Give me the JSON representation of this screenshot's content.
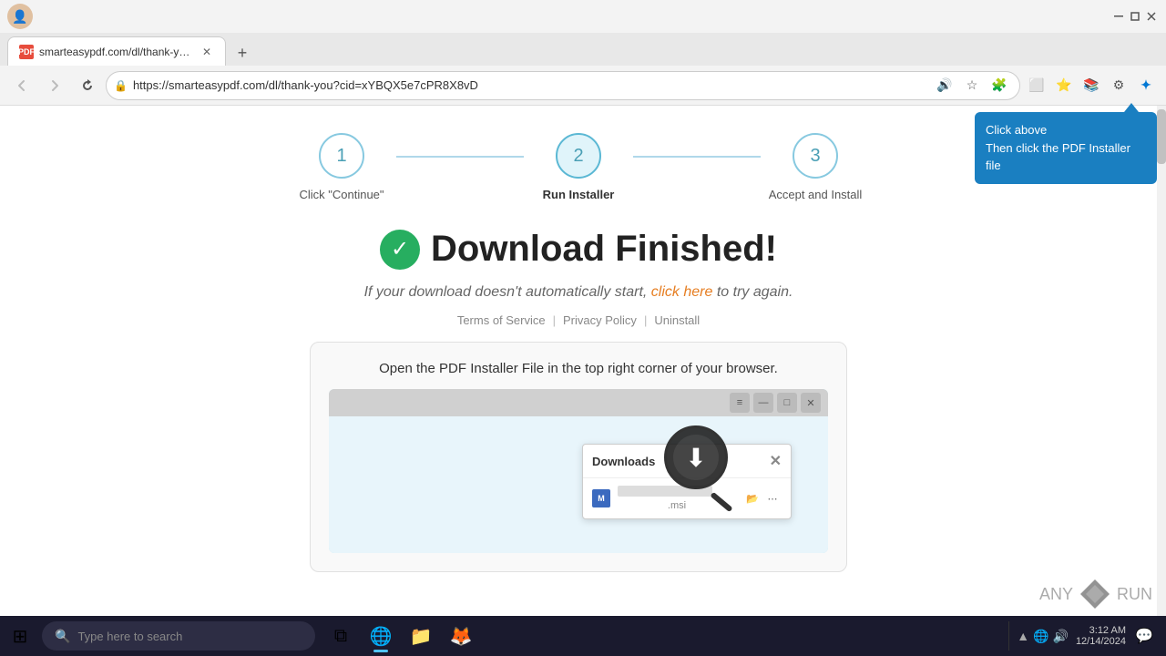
{
  "browser": {
    "tab": {
      "favicon_text": "P",
      "title": "smarteasypdf.com/dl/thank-you..."
    },
    "address": "https://smarteasypdf.com/dl/thank-you?cid=xYBQX5e7cPR8X8vD",
    "nav": {
      "back_title": "Back",
      "forward_title": "Forward",
      "refresh_title": "Refresh",
      "home_title": "Home"
    }
  },
  "steps": [
    {
      "number": "1",
      "label": "Click \"Continue\"",
      "active": false
    },
    {
      "number": "2",
      "label": "Run Installer",
      "active": true
    },
    {
      "number": "3",
      "label": "Accept and Install",
      "active": false
    }
  ],
  "main": {
    "heading": "Download Finished!",
    "subtitle_before": "If your download doesn't automatically start,",
    "subtitle_link": "click here",
    "subtitle_after": "to try again.",
    "links": {
      "terms": "Terms of Service",
      "privacy": "Privacy Policy",
      "uninstall": "Uninstall"
    },
    "instruction": "Open the PDF Installer File in the top right corner of your browser.",
    "dropdown": {
      "header": "Downloads",
      "file_name": "                    .msi"
    }
  },
  "tooltip": {
    "line1": "Click above",
    "line2": "Then click the PDF Installer file"
  },
  "taskbar": {
    "search_placeholder": "Type here to search",
    "time": "3:12 AM",
    "date": "12/14/2024",
    "apps": [
      {
        "name": "task-view",
        "icon": "⧉"
      },
      {
        "name": "edge",
        "icon": "🌐"
      },
      {
        "name": "file-explorer",
        "icon": "📁"
      },
      {
        "name": "firefox",
        "icon": "🦊"
      }
    ]
  }
}
